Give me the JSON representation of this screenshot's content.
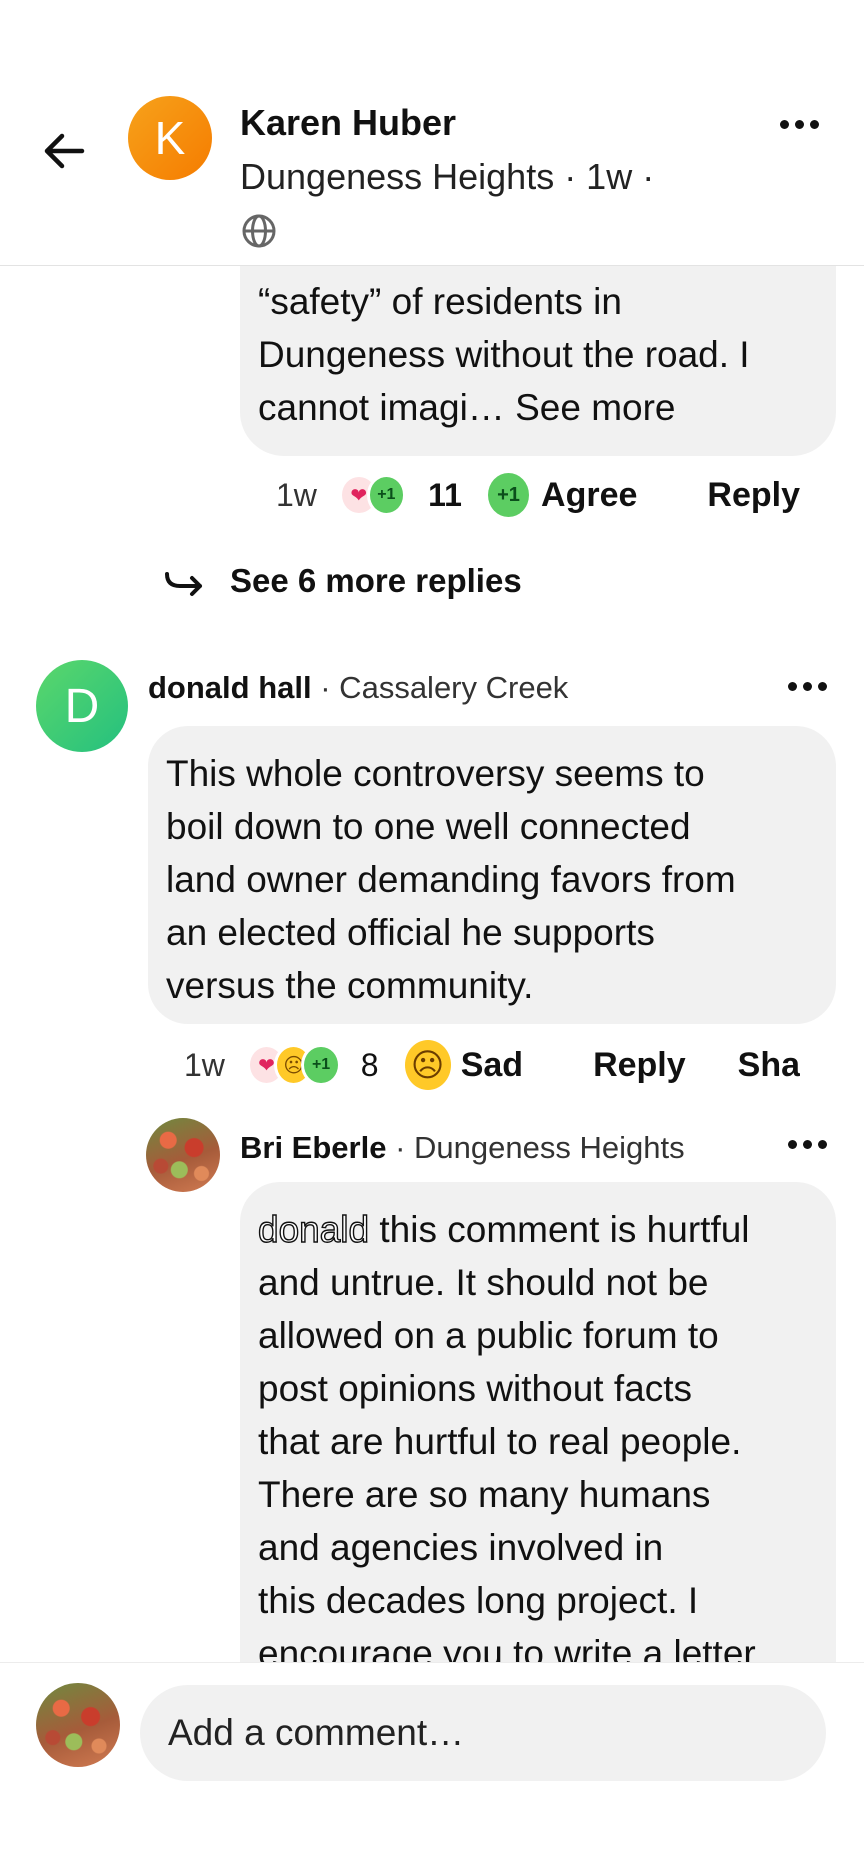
{
  "header": {
    "author": "Karen Huber",
    "meta": "Dungeness Heights · 1w ·",
    "avatar_letter": "K"
  },
  "first_comment": {
    "text_lines": [
      "“safety” of residents in",
      "Dungeness without the road.  I",
      "cannot imagi… "
    ],
    "see_more": "See more",
    "time": "1w",
    "reaction_count": "11",
    "agree_label": "Agree",
    "reply_label": "Reply"
  },
  "see_more_replies": "See 6 more replies",
  "donald": {
    "avatar_letter": "D",
    "name": "donald hall",
    "neighborhood": "· Cassalery Creek",
    "text_lines": [
      "This whole controversy seems to",
      "boil down to one well connected",
      "land owner demanding favors from",
      "an elected official he supports",
      "versus the community."
    ],
    "time": "1w",
    "reaction_count": "8",
    "sad_label": "Sad",
    "reply_label": "Reply",
    "share_label": "Sha"
  },
  "bri": {
    "name": "Bri Eberle",
    "neighborhood": "· Dungeness Heights",
    "mention": "donald",
    "text_lines": [
      " this comment is hurtful",
      "and untrue. It should not be",
      "allowed on a public forum to",
      "post opinions without facts",
      "that are hurtful to real people.",
      "There are so many humans",
      "and agencies involved in",
      "this decades long project. I",
      "encourage you to write a letter"
    ]
  },
  "composer": {
    "placeholder": "Add a comment…"
  },
  "colors": {
    "orange_avatar": "#f57c00",
    "green_avatar": "#3ec96b",
    "bubble": "#f1f1f1"
  }
}
